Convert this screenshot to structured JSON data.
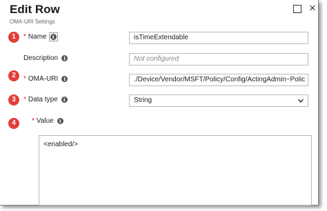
{
  "header": {
    "title": "Edit Row",
    "subtitle": "OMA-URI Settings",
    "close_glyph": "×"
  },
  "badges": [
    "1",
    "2",
    "3",
    "4"
  ],
  "fields": {
    "name": {
      "label": "Name",
      "value": "isTimeExtendable",
      "required": true
    },
    "description": {
      "label": "Description",
      "placeholder": "Not configured",
      "required": false
    },
    "oma_uri": {
      "label": "OMA-URI",
      "value": "./Device/Vendor/MSFT/Policy/Config/ActingAdmin~Polic",
      "required": true
    },
    "data_type": {
      "label": "Data type",
      "selected": "String",
      "required": true
    },
    "value": {
      "label": "Value",
      "content": "<enabled/>",
      "required": true
    }
  },
  "required_marker": "*",
  "info_glyph": "i",
  "colors": {
    "badge": "#e0403a",
    "required": "#d12020"
  }
}
